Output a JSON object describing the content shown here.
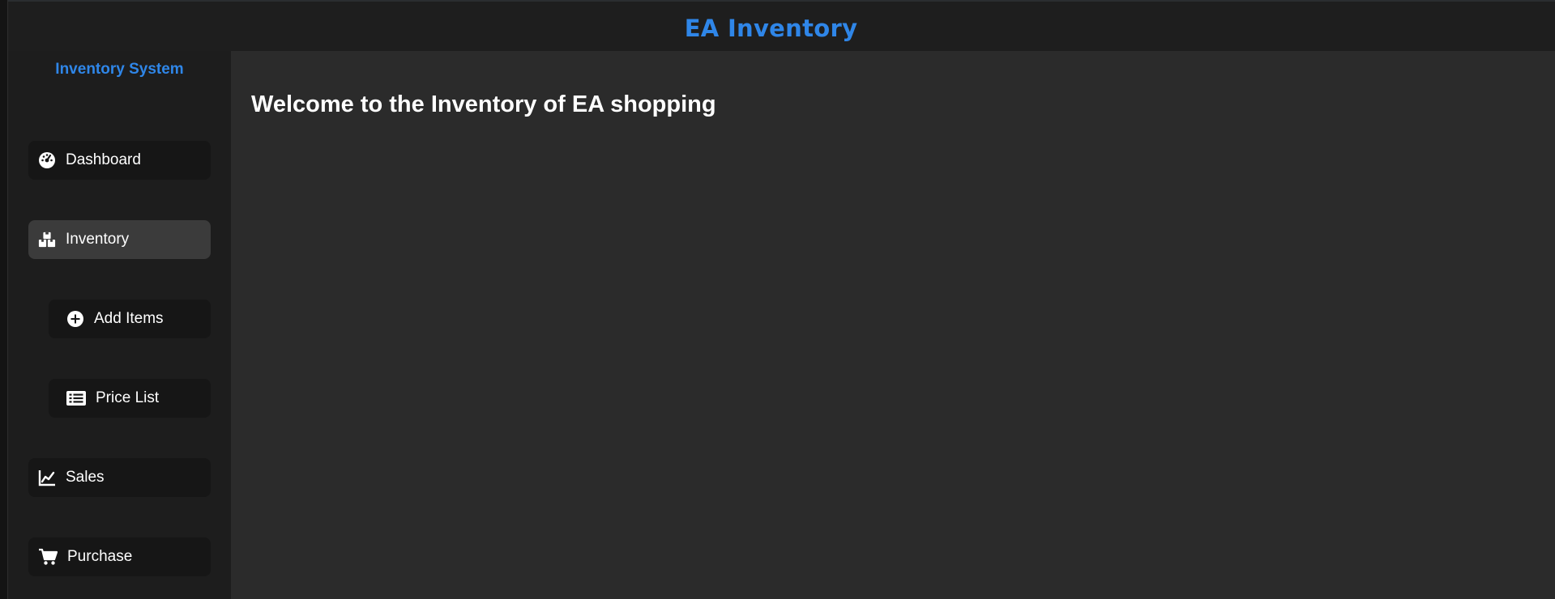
{
  "header": {
    "title": "EA Inventory"
  },
  "sidebar": {
    "brand": "Inventory System",
    "items": [
      {
        "label": "Dashboard",
        "icon": "dashboard-gauge-icon"
      },
      {
        "label": "Inventory",
        "icon": "boxes-icon",
        "active": true
      },
      {
        "label": "Add Items",
        "icon": "plus-circle-icon"
      },
      {
        "label": "Price List",
        "icon": "list-icon"
      },
      {
        "label": "Sales",
        "icon": "line-chart-icon"
      },
      {
        "label": "Purchase",
        "icon": "cart-icon"
      }
    ]
  },
  "main": {
    "welcome": "Welcome to the Inventory of EA shopping"
  },
  "colors": {
    "accent": "#2f86e8",
    "background": "#2b2b2b",
    "sidebar": "#1d1d1d",
    "active_item": "#3b3b3b"
  }
}
